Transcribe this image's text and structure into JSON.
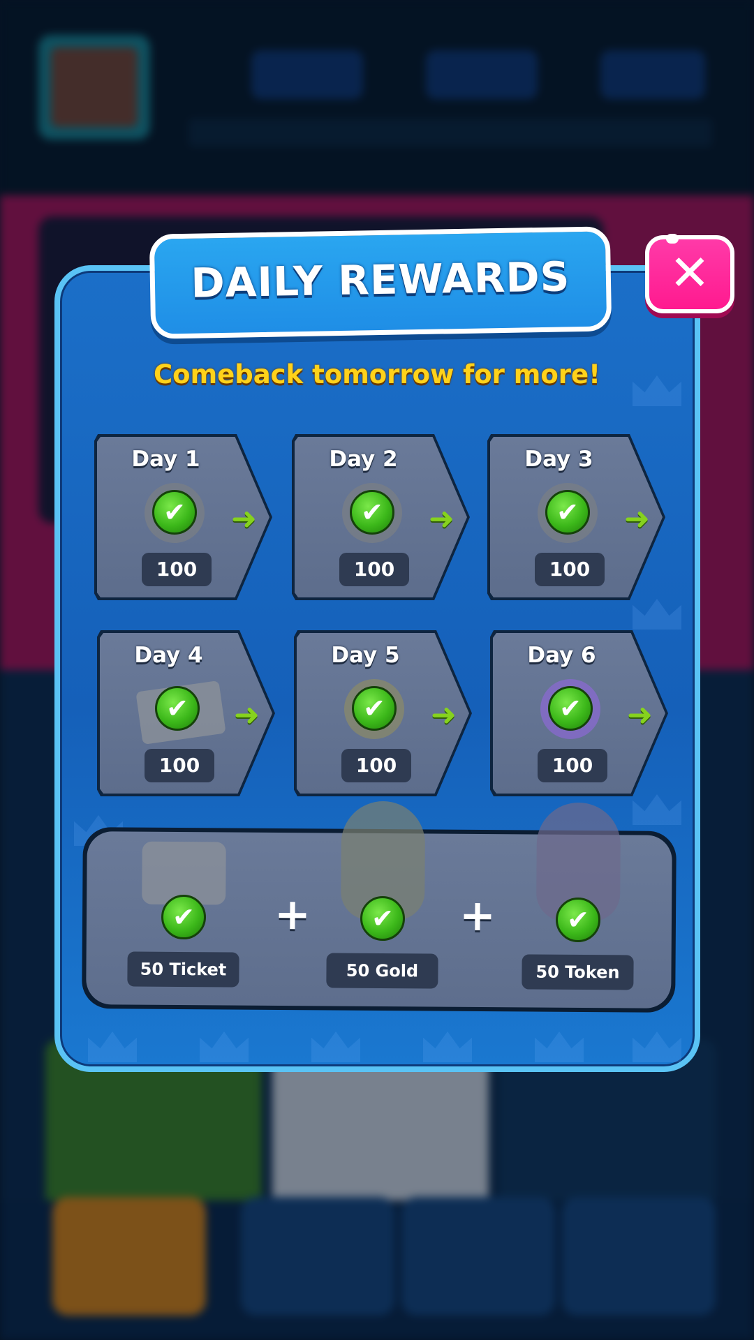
{
  "dialog": {
    "title": "DAILY REWARDS",
    "subtitle": "Comeback tomorrow for more!",
    "close_icon": "✕"
  },
  "days": [
    {
      "label": "Day 1",
      "amount": "100",
      "reward_icon": "coin-icon",
      "claimed": true
    },
    {
      "label": "Day 2",
      "amount": "100",
      "reward_icon": "coin-icon",
      "claimed": true
    },
    {
      "label": "Day 3",
      "amount": "100",
      "reward_icon": "coin-icon",
      "claimed": true
    },
    {
      "label": "Day 4",
      "amount": "100",
      "reward_icon": "ticket-icon",
      "claimed": true
    },
    {
      "label": "Day 5",
      "amount": "100",
      "reward_icon": "gold-coin-icon",
      "claimed": true
    },
    {
      "label": "Day 6",
      "amount": "100",
      "reward_icon": "token-icon",
      "claimed": true
    }
  ],
  "bonus": [
    {
      "amount": "50 Ticket",
      "reward_icon": "ticket-icon",
      "claimed": true
    },
    {
      "amount": "50 Gold",
      "reward_icon": "gold-sack-icon",
      "claimed": true
    },
    {
      "amount": "50 Token",
      "reward_icon": "token-sack-icon",
      "claimed": true
    }
  ],
  "symbols": {
    "check": "✔",
    "arrow": "➜",
    "plus": "+"
  },
  "colors": {
    "modal_blue": "#1560b9",
    "modal_border": "#5ac3f5",
    "title_banner": "#1f8ee6",
    "close_pink": "#ff1a8f",
    "subtitle_yellow": "#ffd21a",
    "card_gray": "#5d6d8c",
    "check_green": "#3cb81a",
    "arrow_green": "#86d21e"
  }
}
